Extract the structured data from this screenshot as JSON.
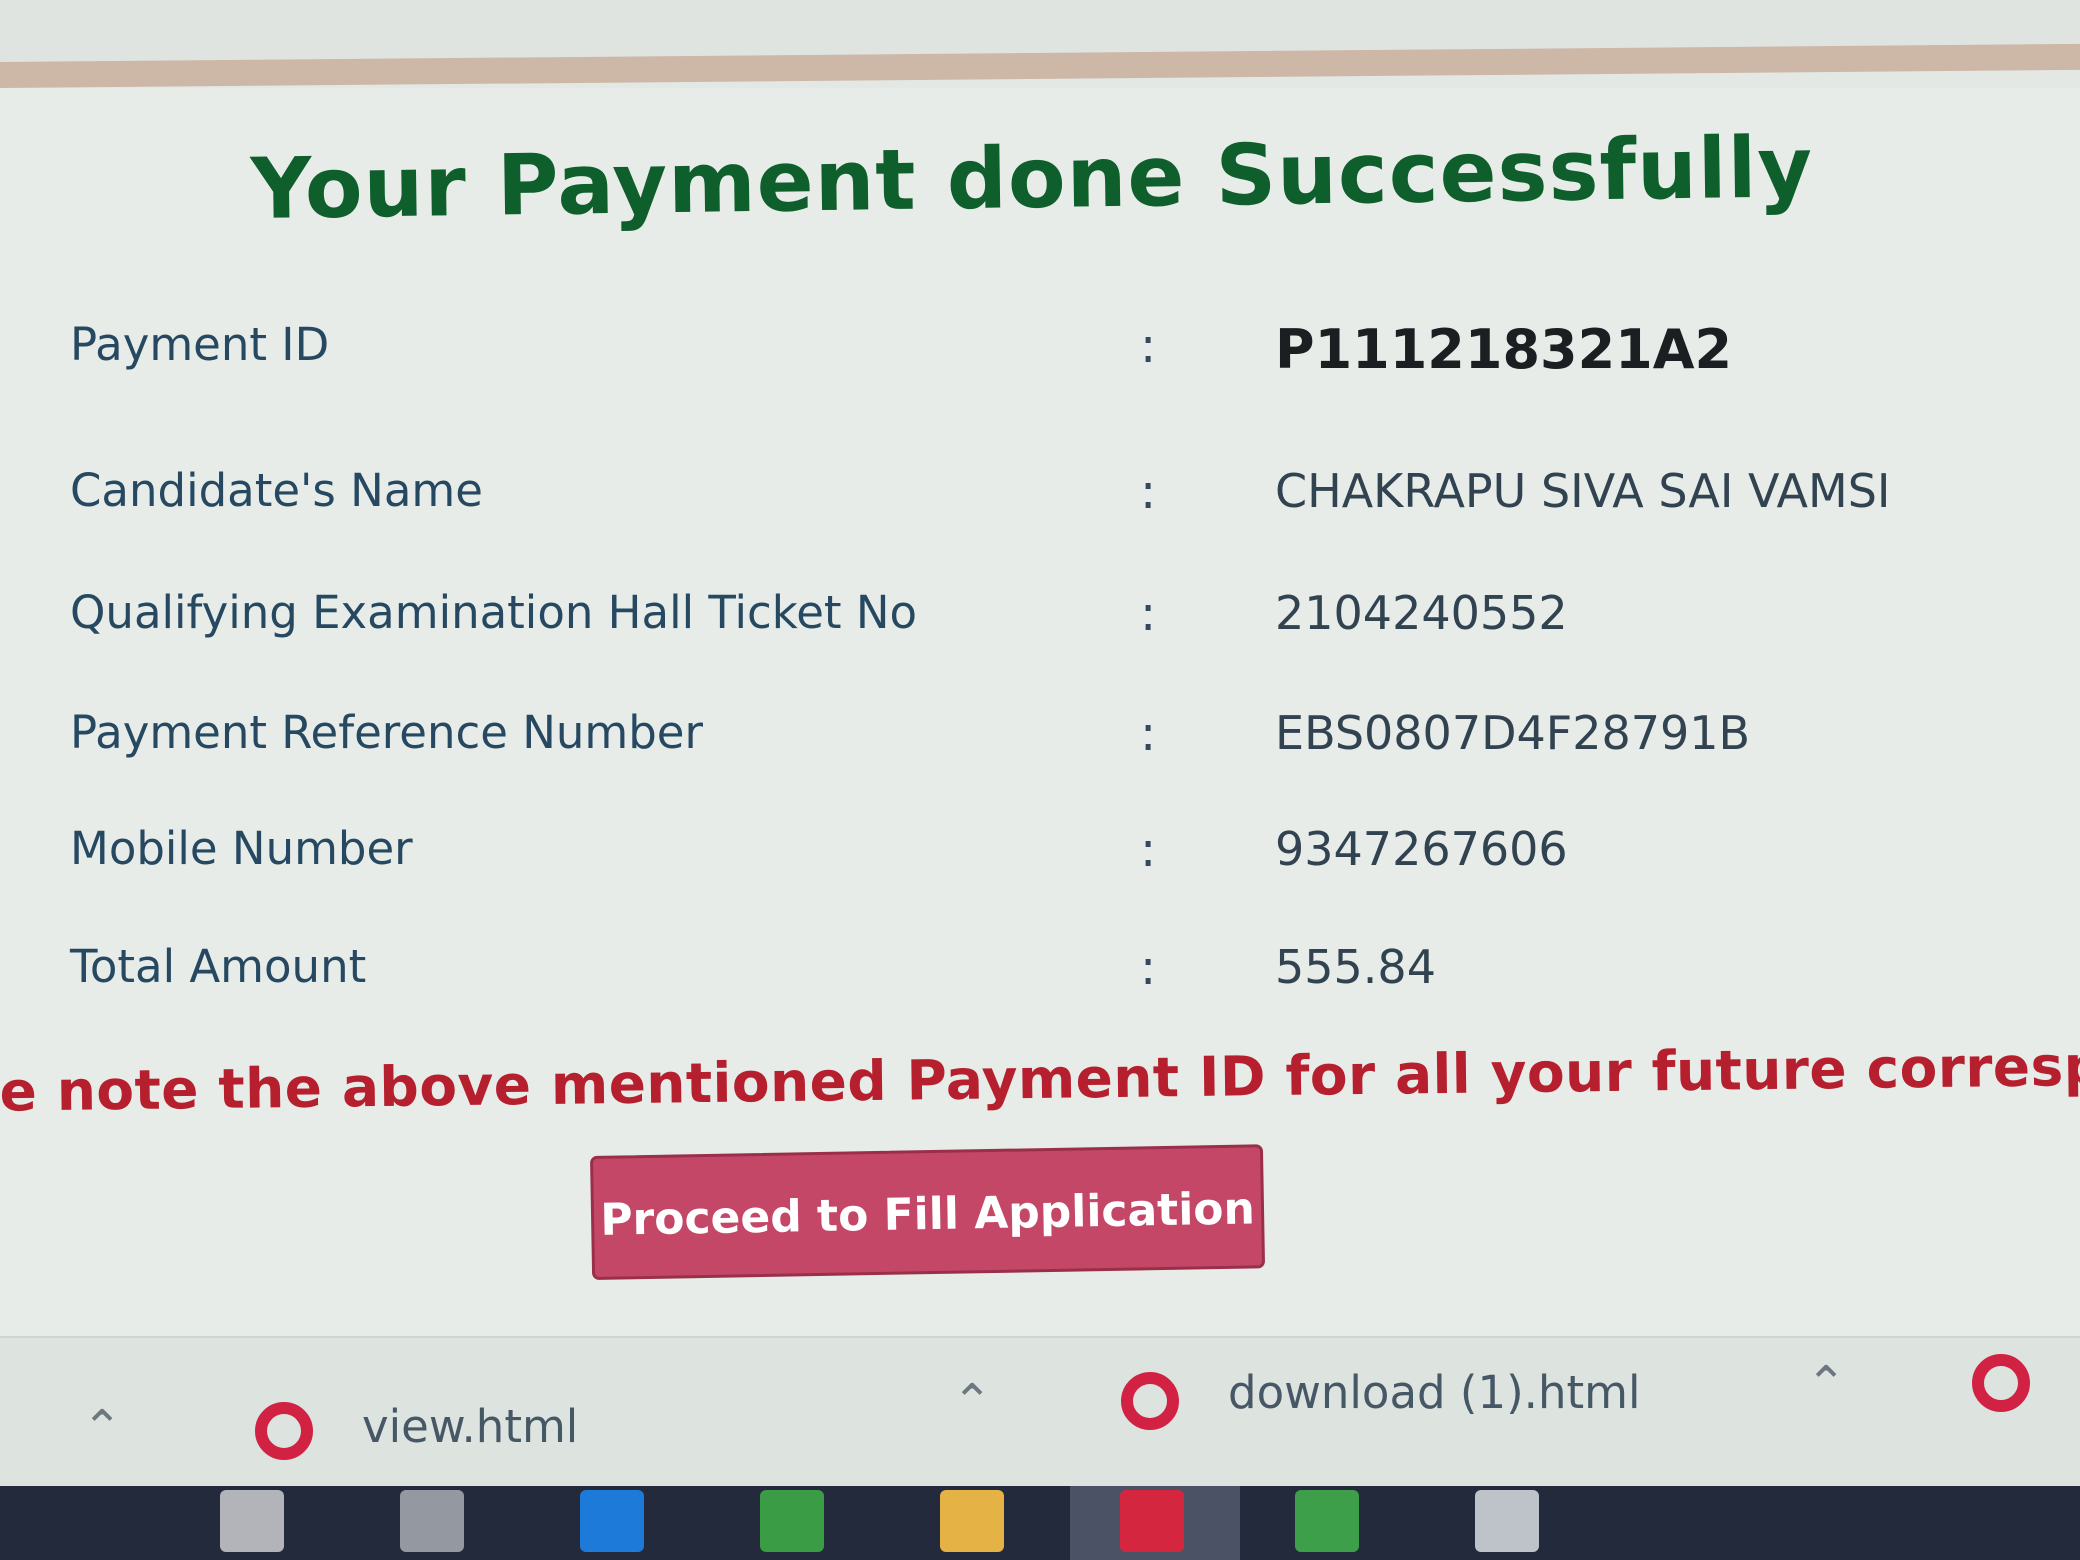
{
  "page": {
    "title": "Your Payment done Successfully",
    "rows": [
      {
        "label": "Payment ID",
        "colon": ":",
        "value": "P111218321A2"
      },
      {
        "label": "Candidate's Name",
        "colon": ":",
        "value": "CHAKRAPU SIVA SAI VAMSI"
      },
      {
        "label": "Qualifying Examination Hall Ticket No",
        "colon": ":",
        "value": "2104240552"
      },
      {
        "label": "Payment Reference Number",
        "colon": ":",
        "value": "EBS0807D4F28791B"
      },
      {
        "label": "Mobile Number",
        "colon": ":",
        "value": "9347267606"
      },
      {
        "label": "Total Amount",
        "colon": ":",
        "value": "555.84"
      }
    ],
    "note": "se note the above mentioned Payment ID for all your future correspondenc",
    "button": "Proceed to Fill Application"
  },
  "downloads": {
    "items": [
      {
        "name": "view.html"
      },
      {
        "name": "download (1).html"
      }
    ]
  },
  "taskbar": {
    "icons": [
      "app-icon",
      "file-icon",
      "edge-icon",
      "chrome-icon",
      "folder-icon",
      "opera-icon",
      "chrome-icon",
      "app-icon"
    ]
  }
}
